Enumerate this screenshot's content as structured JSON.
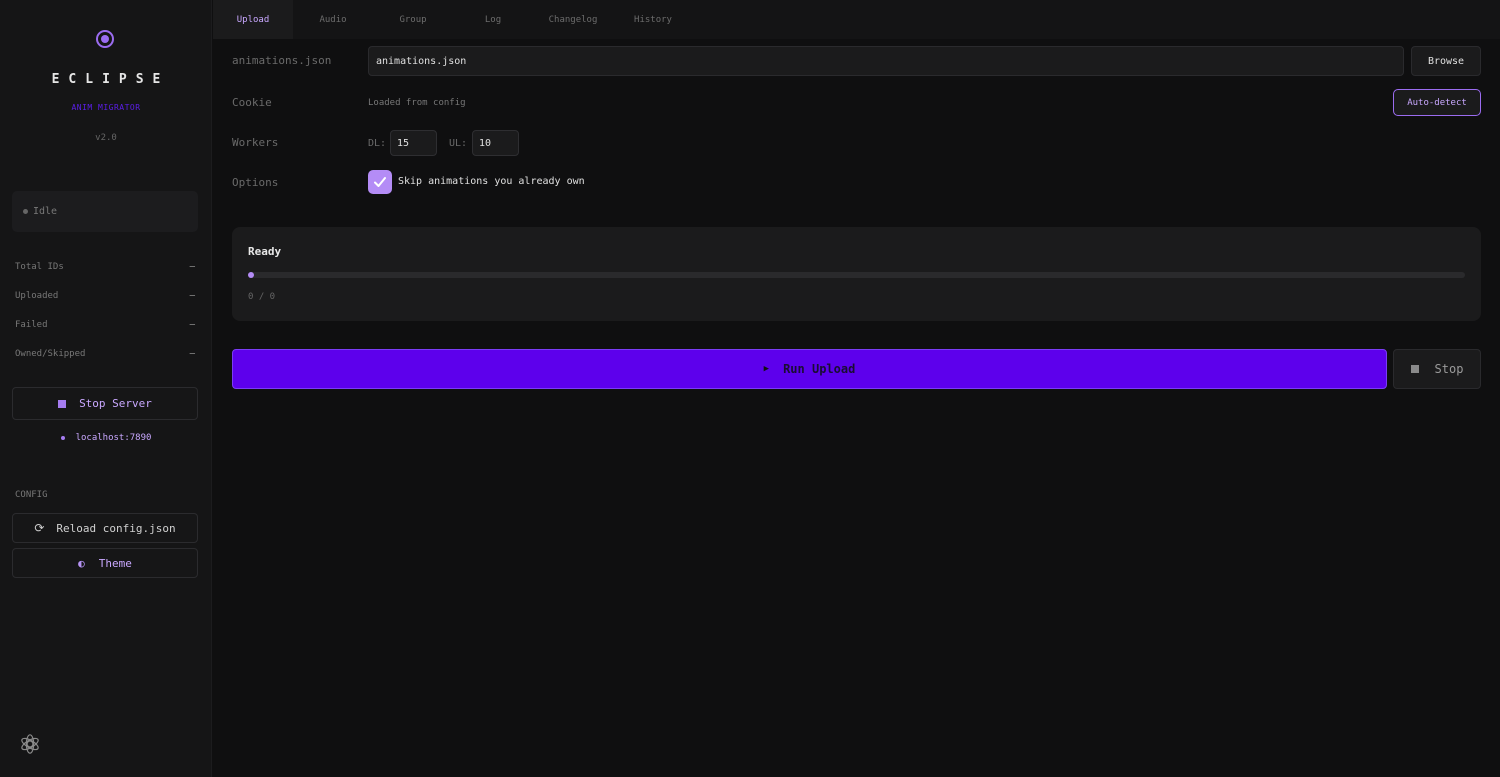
{
  "app": {
    "brand": "ECLIPSE",
    "subtitle": "ANIM MIGRATOR",
    "version": "v2.0",
    "accent_color": "#9b6cf0",
    "primary_color": "#5d00ec"
  },
  "sidebar": {
    "status": "Idle",
    "stats": [
      {
        "label": "Total IDs",
        "value": "—"
      },
      {
        "label": "Uploaded",
        "value": "—"
      },
      {
        "label": "Failed",
        "value": "—"
      },
      {
        "label": "Owned/Skipped",
        "value": "—"
      }
    ],
    "stop_server_label": "Stop Server",
    "server_address": "localhost:7890",
    "config_section_title": "CONFIG",
    "reload_label": "Reload config.json",
    "theme_label": "Theme",
    "icons": {
      "logo": "eclipse-logo-icon",
      "stop": "square-icon",
      "reload": "reload-icon",
      "theme": "half-moon-icon",
      "settings": "gear-icon"
    }
  },
  "tabs": [
    {
      "label": "Upload",
      "active": true
    },
    {
      "label": "Audio",
      "active": false
    },
    {
      "label": "Group",
      "active": false
    },
    {
      "label": "Log",
      "active": false
    },
    {
      "label": "Changelog",
      "active": false
    },
    {
      "label": "History",
      "active": false
    }
  ],
  "form": {
    "file_label": "animations.json",
    "file_value": "animations.json",
    "browse_label": "Browse",
    "cookie_label": "Cookie",
    "cookie_status": "Loaded from config",
    "autodetect_label": "Auto-detect",
    "workers_label": "Workers",
    "dl_label": "DL:",
    "dl_value": "15",
    "ul_label": "UL:",
    "ul_value": "10",
    "options_label": "Options",
    "skip_owned_label": "Skip animations you already own",
    "skip_owned_checked": true
  },
  "progress": {
    "title": "Ready",
    "count_text": "0 / 0",
    "fraction": 0
  },
  "actions": {
    "run_label": "Run Upload",
    "stop_label": "Stop"
  }
}
